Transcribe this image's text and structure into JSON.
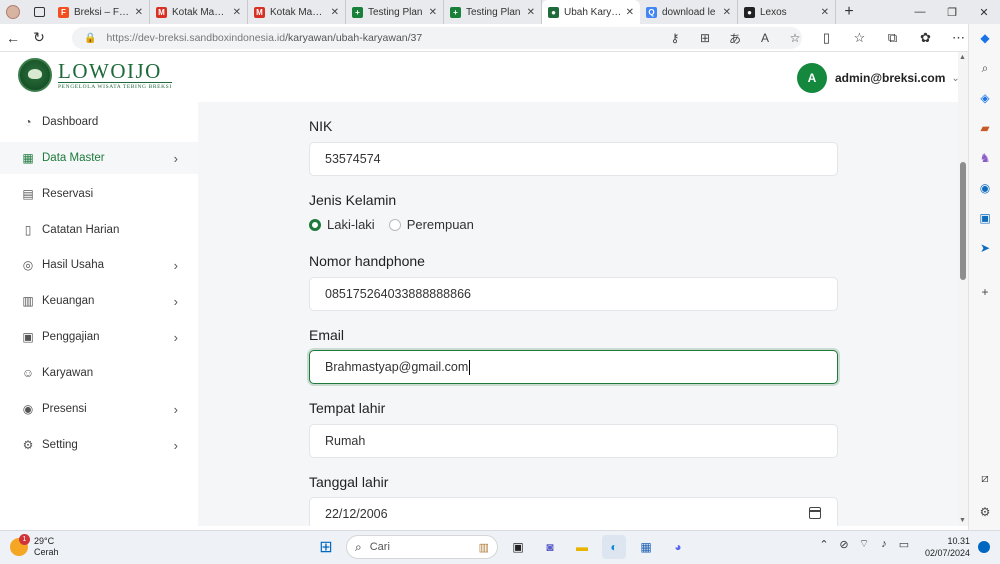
{
  "browser": {
    "tabs": [
      {
        "title": "Breksi – Figma",
        "color": "#f24e1e",
        "glyph": "F",
        "active": false
      },
      {
        "title": "Kotak Masuk",
        "color": "#d93025",
        "glyph": "M",
        "active": false
      },
      {
        "title": "Kotak Masuk",
        "color": "#d93025",
        "glyph": "M",
        "active": false
      },
      {
        "title": "Testing Plan",
        "color": "#188038",
        "glyph": "+",
        "active": false
      },
      {
        "title": "Testing Plan",
        "color": "#188038",
        "glyph": "+",
        "active": false
      },
      {
        "title": "Ubah Karyawan",
        "color": "#1e6a3a",
        "glyph": "●",
        "active": true
      },
      {
        "title": "download le",
        "color": "#4285f4",
        "glyph": "Q",
        "active": false
      },
      {
        "title": "Lexos",
        "color": "#222222",
        "glyph": "●",
        "active": false
      }
    ],
    "new_tab_label": "+",
    "url_host": "https://dev-breksi.sandboxindonesia.id",
    "url_path": "/karyawan/ubah-karyawan/37"
  },
  "app": {
    "brand": "LOWOIJO",
    "brand_sub": "PENGELOLA WISATA TEBING BREKSI",
    "user_initial": "A",
    "user_email": "admin@breksi.com",
    "accent_color": "#1e7a3c"
  },
  "sidebar": {
    "items": [
      {
        "label": "Dashboard",
        "icon": "dashboard-icon",
        "glyph": "◔",
        "arrow": false,
        "selected": false
      },
      {
        "label": "Data Master",
        "icon": "grid-icon",
        "glyph": "▦",
        "arrow": true,
        "selected": true
      },
      {
        "label": "Reservasi",
        "icon": "reservation-icon",
        "glyph": "▤",
        "arrow": false,
        "selected": false
      },
      {
        "label": "Catatan Harian",
        "icon": "document-icon",
        "glyph": "▯",
        "arrow": false,
        "selected": false
      },
      {
        "label": "Hasil Usaha",
        "icon": "money-icon",
        "glyph": "◎",
        "arrow": true,
        "selected": false
      },
      {
        "label": "Keuangan",
        "icon": "finance-icon",
        "glyph": "▥",
        "arrow": true,
        "selected": false
      },
      {
        "label": "Penggajian",
        "icon": "payroll-icon",
        "glyph": "▣",
        "arrow": true,
        "selected": false
      },
      {
        "label": "Karyawan",
        "icon": "people-icon",
        "glyph": "☺",
        "arrow": false,
        "selected": false
      },
      {
        "label": "Presensi",
        "icon": "presence-icon",
        "glyph": "◉",
        "arrow": true,
        "selected": false
      },
      {
        "label": "Setting",
        "icon": "gear-icon",
        "glyph": "⚙",
        "arrow": true,
        "selected": false
      }
    ]
  },
  "form": {
    "nik_label": "NIK",
    "nik_value": "53574574",
    "gender_label": "Jenis Kelamin",
    "gender_options": [
      "Laki-laki",
      "Perempuan"
    ],
    "gender_selected": "Laki-laki",
    "phone_label": "Nomor handphone",
    "phone_value": "085175264033888888866",
    "email_label": "Email",
    "email_value": "Brahmastyap@gmail.com",
    "birthplace_label": "Tempat lahir",
    "birthplace_value": "Rumah",
    "birthdate_label": "Tanggal lahir",
    "birthdate_value": "22/12/2006"
  },
  "taskbar": {
    "weather_badge": "1",
    "temperature": "29°C",
    "condition": "Cerah",
    "search_placeholder": "Cari",
    "time": "10.31",
    "date": "02/07/2024"
  }
}
